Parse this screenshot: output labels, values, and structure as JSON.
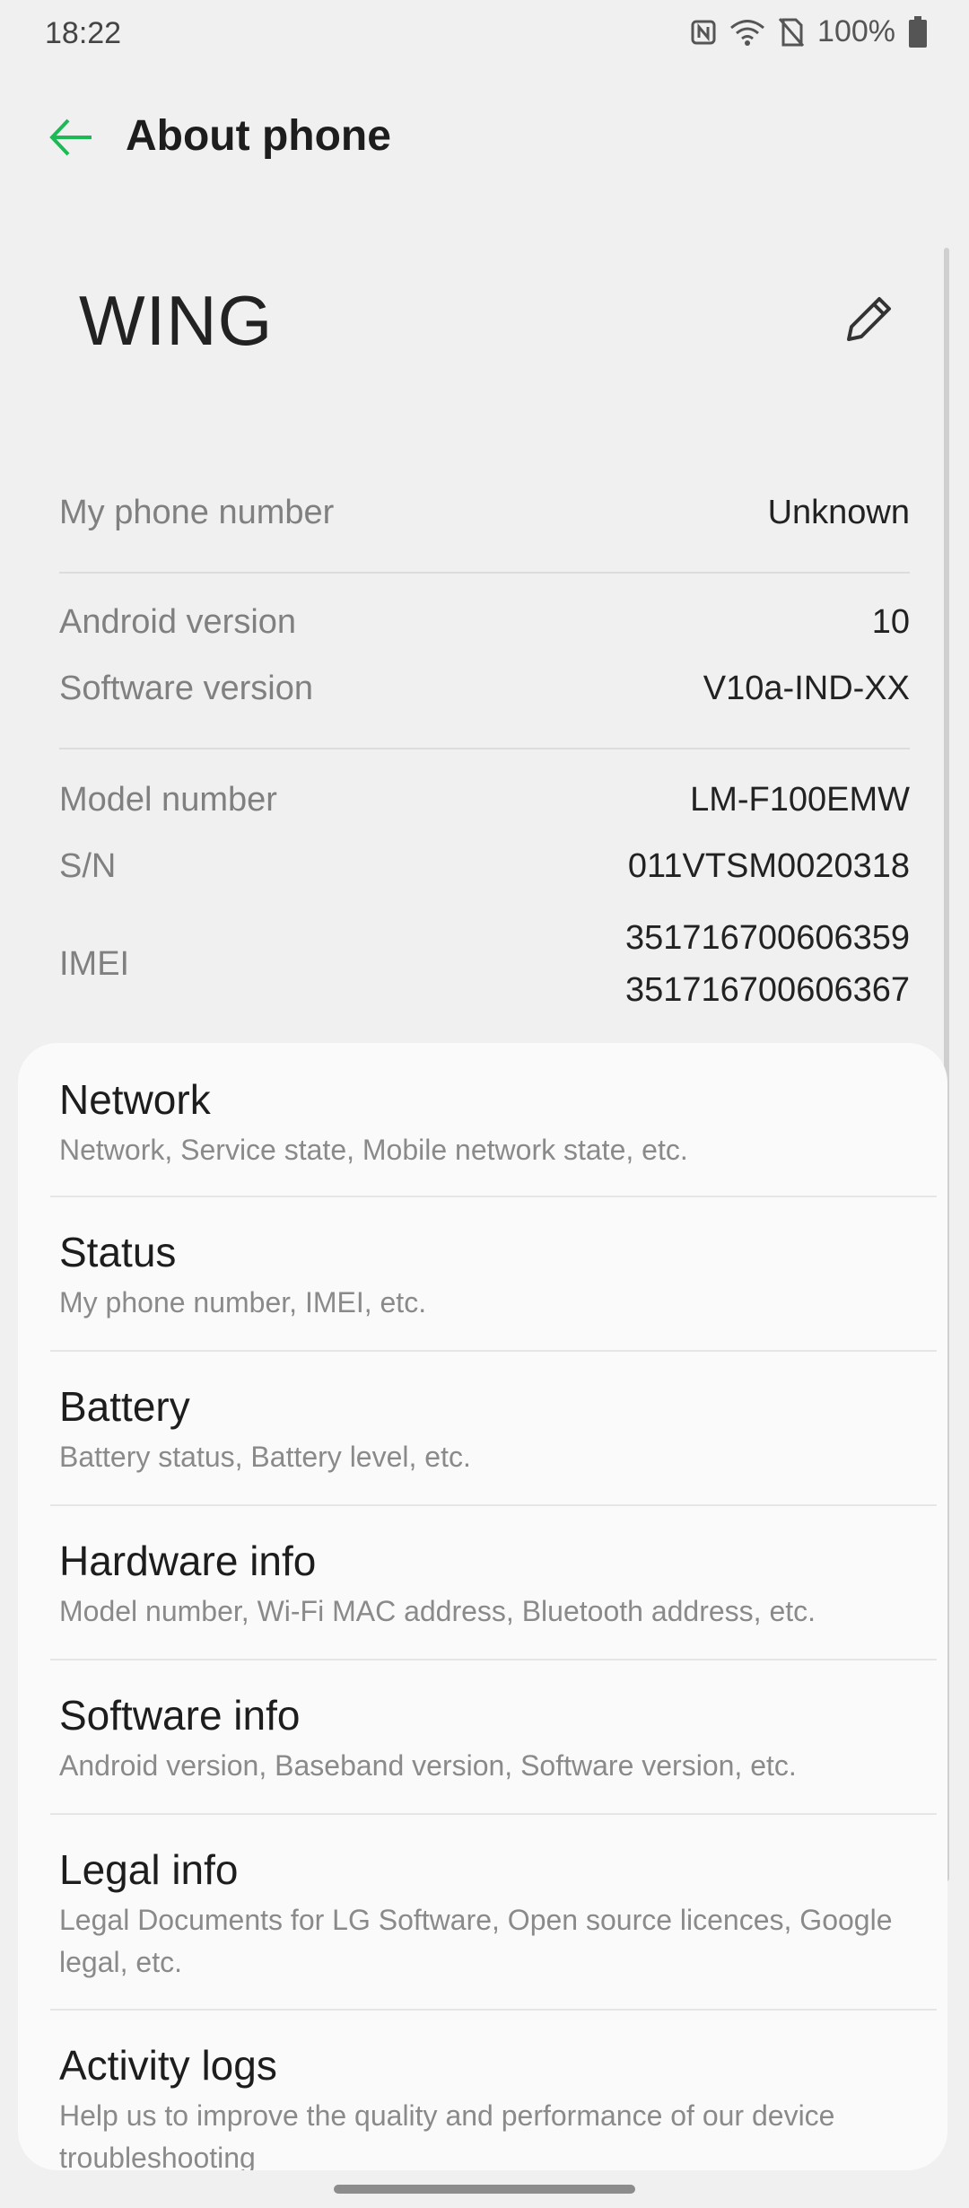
{
  "status_bar": {
    "time": "18:22",
    "battery_percent": "100%",
    "icons": [
      "nfc-icon",
      "wifi-icon",
      "no-sim-icon",
      "battery-icon"
    ]
  },
  "app_bar": {
    "title": "About phone",
    "back_icon": "arrow-left-icon",
    "accent_color": "#1db954"
  },
  "device": {
    "name": "WING",
    "edit_icon": "pencil-icon"
  },
  "info": {
    "phone_number": {
      "label": "My phone number",
      "value": "Unknown"
    },
    "android_version": {
      "label": "Android version",
      "value": "10"
    },
    "software_version": {
      "label": "Software version",
      "value": "V10a-IND-XX"
    },
    "model_number": {
      "label": "Model number",
      "value": "LM-F100EMW"
    },
    "serial": {
      "label": "S/N",
      "value": "011VTSM0020318"
    },
    "imei": {
      "label": "IMEI",
      "value_1": "351716700606359",
      "value_2": "351716700606367"
    }
  },
  "menu": {
    "items": [
      {
        "title": "Network",
        "subtitle": "Network, Service state, Mobile network state, etc."
      },
      {
        "title": "Status",
        "subtitle": "My phone number, IMEI, etc."
      },
      {
        "title": "Battery",
        "subtitle": "Battery status, Battery level, etc."
      },
      {
        "title": "Hardware info",
        "subtitle": "Model number, Wi-Fi MAC address, Bluetooth address, etc."
      },
      {
        "title": "Software info",
        "subtitle": "Android version, Baseband version, Software version, etc."
      },
      {
        "title": "Legal info",
        "subtitle": "Legal Documents for LG Software, Open source licences, Google legal, etc."
      },
      {
        "title": "Activity logs",
        "subtitle": "Help us to improve the quality and performance of our device troubleshooting"
      }
    ]
  }
}
